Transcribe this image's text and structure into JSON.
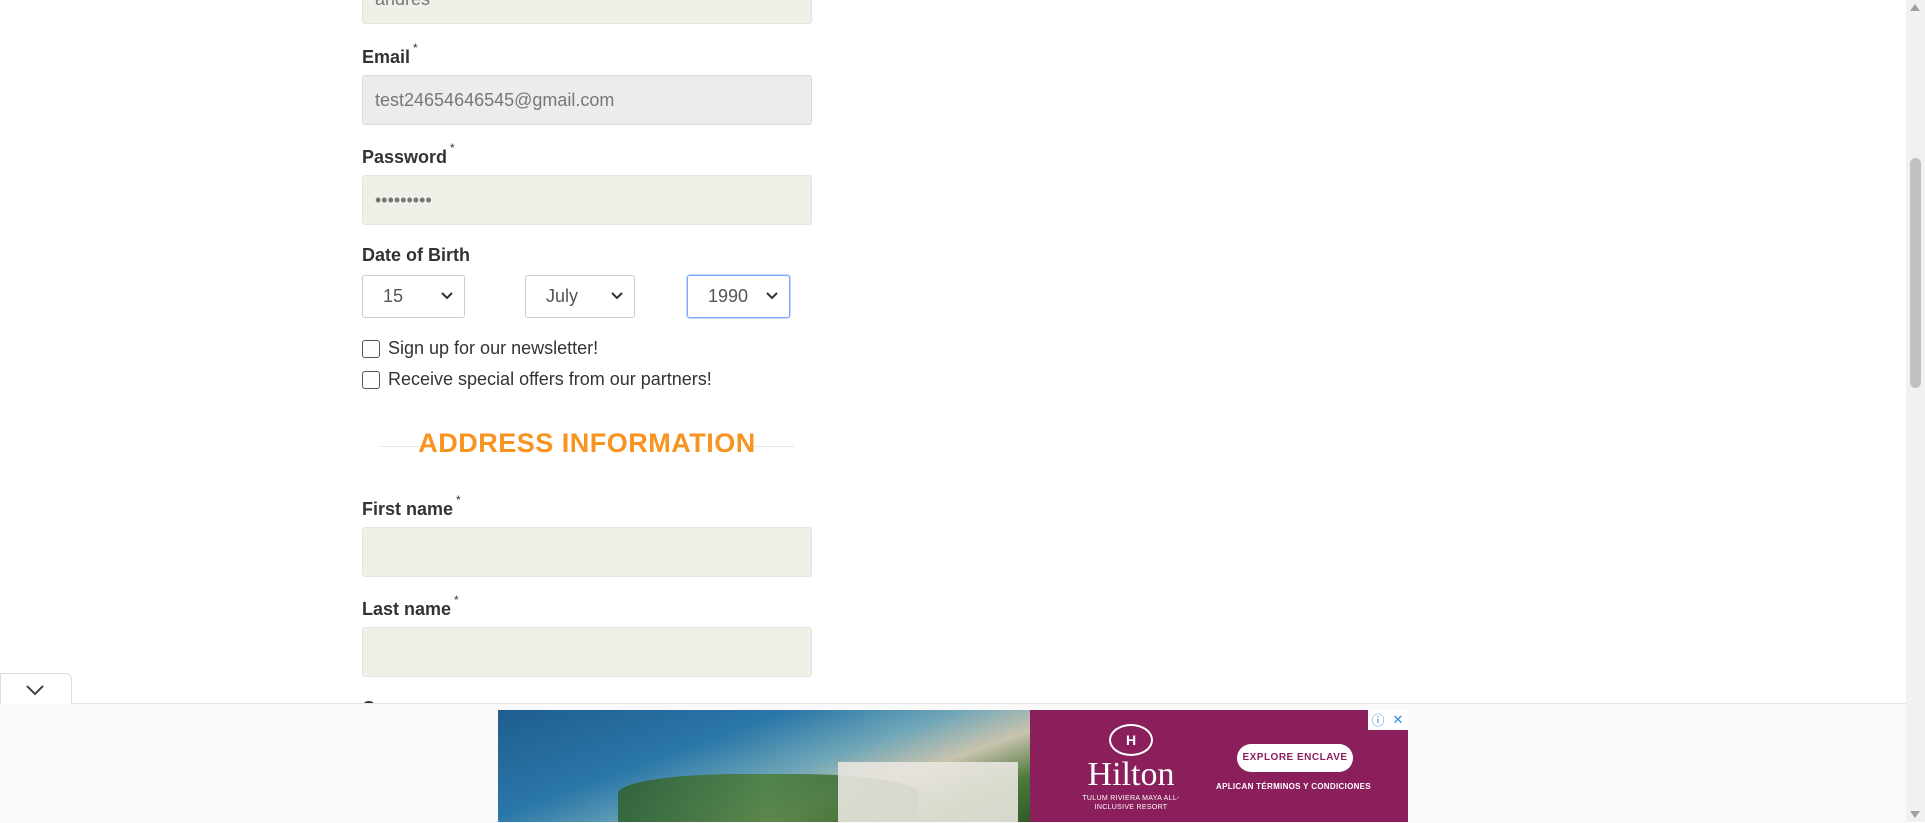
{
  "form": {
    "prev_field_value": "andres",
    "email": {
      "label": "Email",
      "required": "*",
      "value": "test24654646545@gmail.com"
    },
    "password": {
      "label": "Password",
      "required": "*",
      "value": "•••••••••"
    },
    "dob": {
      "label": "Date of Birth",
      "day": "15",
      "month": "July",
      "year": "1990"
    },
    "newsletter_label": "Sign up for our newsletter!",
    "offers_label": "Receive special offers from our partners!",
    "address_section_title": "ADDRESS INFORMATION",
    "first_name": {
      "label": "First name",
      "required": "*",
      "value": ""
    },
    "last_name": {
      "label": "Last name",
      "required": "*",
      "value": ""
    },
    "partial_label": "C"
  },
  "ad": {
    "brand": "Hilton",
    "brand_mark": "H",
    "subtitle": "TULUM RIVIERA MAYA ALL-INCLUSIVE RESORT",
    "cta": "EXPLORE ENCLAVE",
    "terms": "APLICAN TÉRMINOS Y CONDICIONES",
    "info_icon": "ⓘ",
    "close_icon": "✕"
  },
  "colors": {
    "section_title": "#f7931e",
    "ad_brand_bg": "#8a1f5c",
    "focus_border": "#7aa7ff"
  }
}
